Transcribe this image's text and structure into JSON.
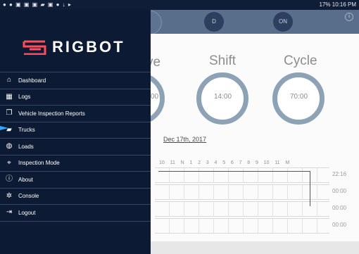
{
  "status_bar": {
    "left_icons": "● ● ▣ ▣ ▣ ▰ ▣ ● ↓ ▸",
    "right_text": "17% 10:16 PM"
  },
  "top_bar": {
    "status_d": "D",
    "status_on": "ON"
  },
  "gauges": {
    "drive_title": "ve",
    "drive_value": "00",
    "shift_title": "Shift",
    "shift_value": "14:00",
    "cycle_title": "Cycle",
    "cycle_value": "70:00"
  },
  "log": {
    "date": "Dec 17th, 2017",
    "hours": [
      "10",
      "11",
      "N",
      "1",
      "2",
      "3",
      "4",
      "5",
      "6",
      "7",
      "8",
      "9",
      "10",
      "11",
      "M"
    ],
    "totals": [
      "22:16",
      "00:00",
      "00:00",
      "00:00"
    ]
  },
  "drawer": {
    "brand": "RIGBOT",
    "items": [
      {
        "label": "Dashboard",
        "icon": "home-icon"
      },
      {
        "label": "Logs",
        "icon": "calendar-icon"
      },
      {
        "label": "Vehicle Inspection Reports",
        "icon": "copy-icon"
      },
      {
        "label": "Trucks",
        "icon": "truck-icon"
      },
      {
        "label": "Loads",
        "icon": "load-icon"
      },
      {
        "label": "Inspection Mode",
        "icon": "map-pin-icon"
      },
      {
        "label": "About",
        "icon": "info-icon"
      },
      {
        "label": "Console",
        "icon": "bug-icon"
      },
      {
        "label": "Logout",
        "icon": "logout-icon"
      }
    ]
  },
  "colors": {
    "drawer_bg": "#0c1b33",
    "ring_color": "#8ea2b5",
    "topbar": "#596e8b"
  }
}
